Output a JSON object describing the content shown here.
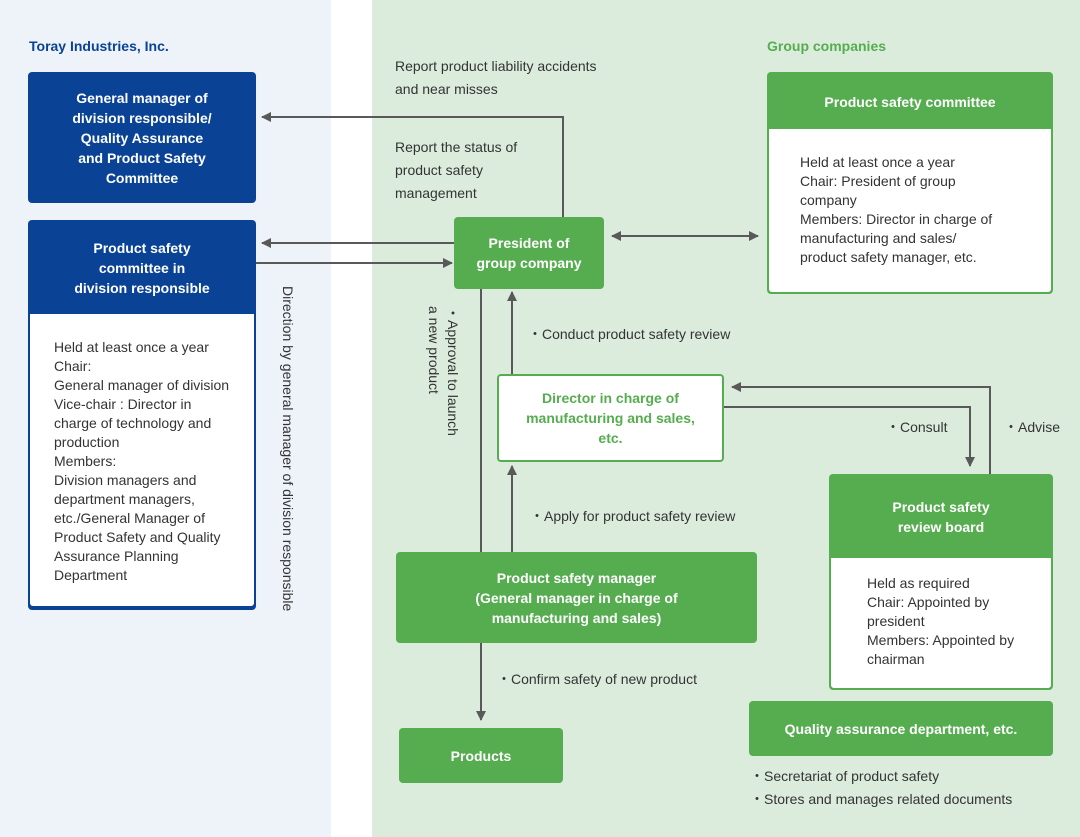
{
  "sections": {
    "left_heading": "Toray Industries, Inc.",
    "right_heading": "Group companies"
  },
  "colors": {
    "toray_blue": "#0a4396",
    "group_green": "#56ad50",
    "left_bg": "#eef3fa",
    "right_bg": "#dcecdc",
    "connector": "#595959"
  },
  "nodes": {
    "gm_division": {
      "title": "General manager of\ndivision responsible/\nQuality Assurance\nand Product Safety\nCommittee"
    },
    "psc_division": {
      "title": "Product safety\ncommittee in\ndivision responsible",
      "details": "Held at least once a year\nChair:\nGeneral manager of division\nVice-chair : Director in\ncharge of technology and\nproduction\nMembers:\nDivision managers and\ndepartment managers,\netc./General Manager of\nProduct Safety and Quality\nAssurance Planning\nDepartment"
    },
    "president": {
      "title": "President of\ngroup company"
    },
    "group_psc": {
      "title": "Product safety committee",
      "details": "Held at least once a year\nChair: President of group\ncompany\nMembers: Director in charge of\nmanufacturing and sales/\nproduct safety manager, etc."
    },
    "director": {
      "title": "Director in charge of\nmanufacturing and sales,\netc."
    },
    "review_board": {
      "title": "Product safety\nreview board",
      "details": "Held as required\nChair: Appointed by\npresident\nMembers: Appointed by\nchairman"
    },
    "ps_manager": {
      "title": "Product safety manager\n(General manager in charge of\nmanufacturing and sales)"
    },
    "products": {
      "title": "Products"
    },
    "qa_dept": {
      "title": "Quality assurance department, etc.",
      "notes": [
        "・Secretariat of product safety",
        "・Stores and manages related documents"
      ]
    }
  },
  "edge_labels": {
    "report_accidents": "Report product liability accidents\nand near misses",
    "report_status": "Report the status of\nproduct safety\nmanagement",
    "direction": "Direction by general manager of division responsible",
    "approval": "・Approval to launch\na new product",
    "conduct_review": "・Conduct product safety review",
    "apply_review": "・Apply for product safety review",
    "consult": "・Consult",
    "advise": "・Advise",
    "confirm_safety": "・Confirm safety of new product"
  }
}
